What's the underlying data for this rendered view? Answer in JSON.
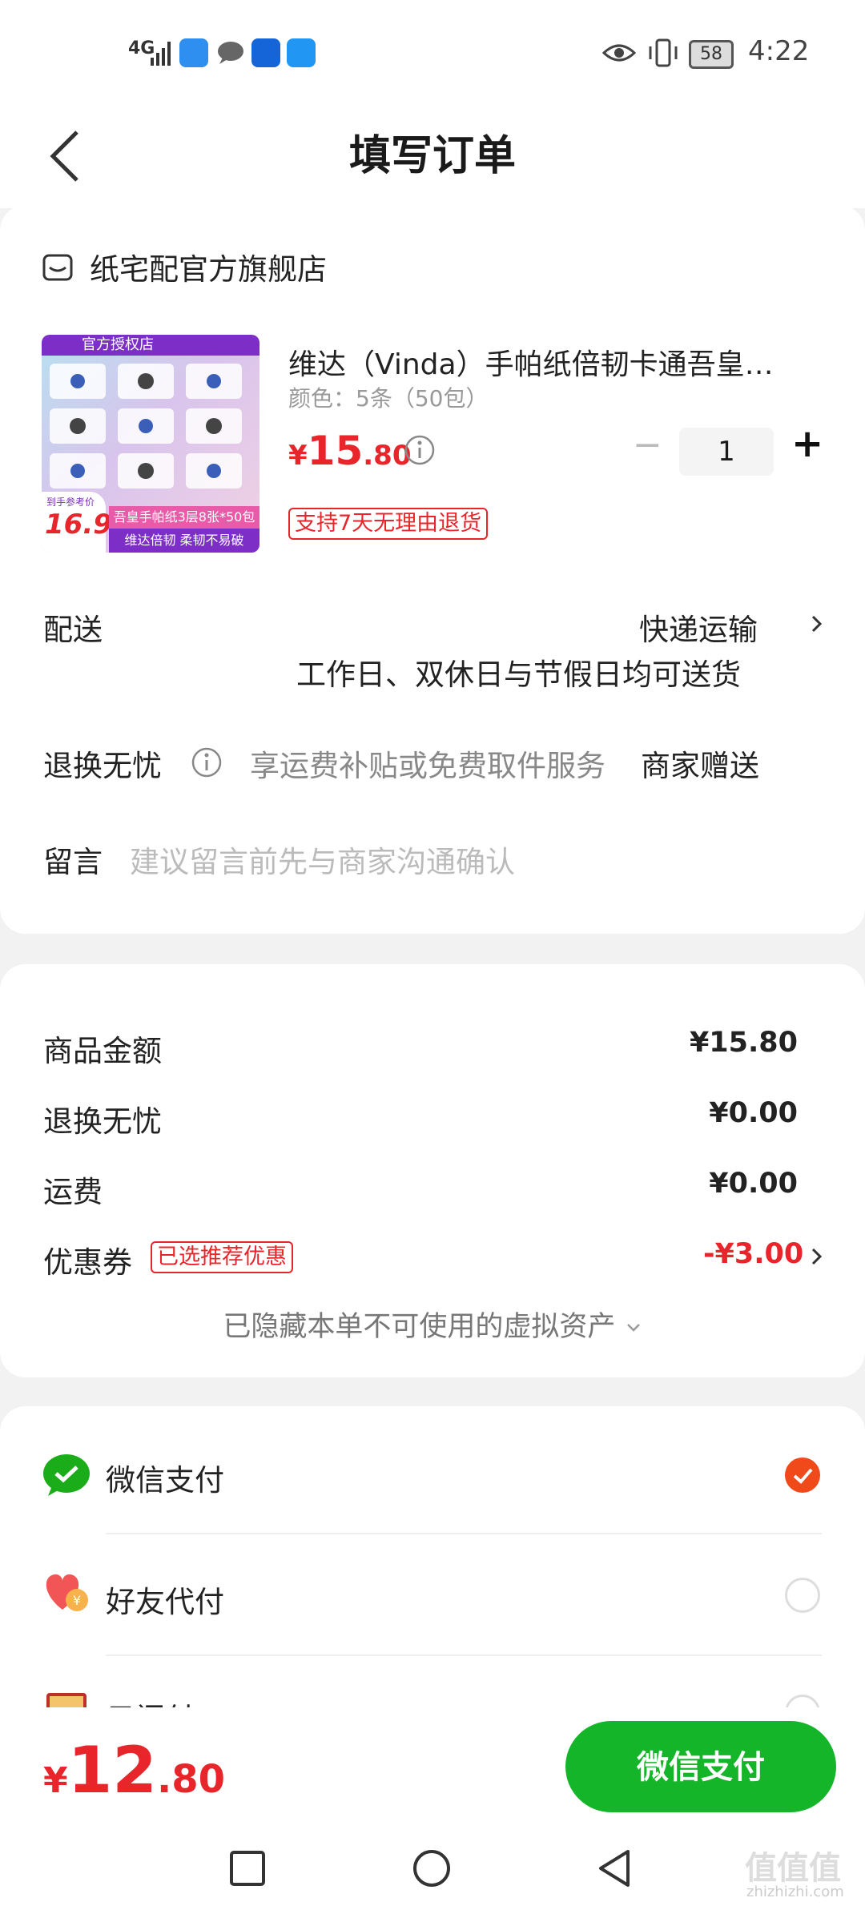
{
  "status_bar": {
    "network": "4G",
    "battery": "58",
    "time": "4:22"
  },
  "header": {
    "title": "填写订单"
  },
  "shop": {
    "name": "纸宅配官方旗舰店"
  },
  "product": {
    "title": "维达（Vinda）手帕纸倍韧卡通吾皇…",
    "spec": "颜色：5条（50包）",
    "currency": "¥",
    "price_int": "15",
    "price_dec": ".80",
    "quantity": "1",
    "minus": "−",
    "plus": "+",
    "return_tag": "支持7天无理由退货",
    "thumb_banner": "官方授权店",
    "thumb_caption1": "吾皇手帕纸3层8张*50包",
    "thumb_caption2": "维达倍韧 柔韧不易破",
    "thumb_price_label": "到手参考价",
    "thumb_price": "16.9"
  },
  "delivery": {
    "label": "配送",
    "method": "快递运输",
    "note": "工作日、双休日与节假日均可送货"
  },
  "return_worry": {
    "label": "退换无忧",
    "desc": "享运费补贴或免费取件服务",
    "value": "商家赠送"
  },
  "message": {
    "label": "留言",
    "placeholder": "建议留言前先与商家沟通确认"
  },
  "summary": {
    "rows": [
      {
        "label": "商品金额",
        "value": "¥15.80"
      },
      {
        "label": "退换无忧",
        "value": "¥0.00"
      },
      {
        "label": "运费",
        "value": "¥0.00"
      }
    ],
    "coupon_label": "优惠券",
    "coupon_tag": "已选推荐优惠",
    "coupon_value": "-¥3.00",
    "hidden_assets": "已隐藏本单不可使用的虚拟资产"
  },
  "payment": {
    "methods": [
      {
        "label": "微信支付",
        "selected": true
      },
      {
        "label": "好友代付",
        "selected": false
      },
      {
        "label": "云闪付",
        "selected": false
      }
    ]
  },
  "bottom": {
    "currency": "¥",
    "total_int": "12",
    "total_dec": ".80",
    "pay_button": "微信支付"
  },
  "watermark": {
    "text": "值值值",
    "sub": "zhizhizhi.com"
  },
  "colors": {
    "accent_red": "#e8252b",
    "wechat_green": "#14b529",
    "selected_orange": "#f04a1a"
  }
}
